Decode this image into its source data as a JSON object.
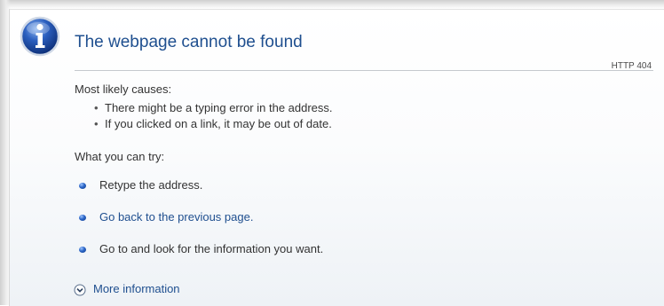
{
  "page": {
    "title": "The webpage cannot be found",
    "http_code": "HTTP 404"
  },
  "causes": {
    "heading": "Most likely causes:",
    "items": [
      "There might be a typing error in the address.",
      "If you clicked on a link, it may be out of date."
    ]
  },
  "try": {
    "heading": "What you can try:",
    "items": [
      {
        "text": "Retype the address.",
        "link": false
      },
      {
        "text": "Go back to the previous page.",
        "link": true
      },
      {
        "text": "Go to  and look for the information you want.",
        "link": false
      }
    ]
  },
  "more_info": {
    "label": "More information"
  },
  "icons": {
    "info": "info-icon",
    "bullet": "blue-bullet-icon",
    "expand": "expand-chevron-icon"
  },
  "colors": {
    "title": "#1f4f8f",
    "link": "#1f4f8f",
    "text": "#333333",
    "rule": "#c5c9ce",
    "icon_blue": "#1e4fa8"
  }
}
